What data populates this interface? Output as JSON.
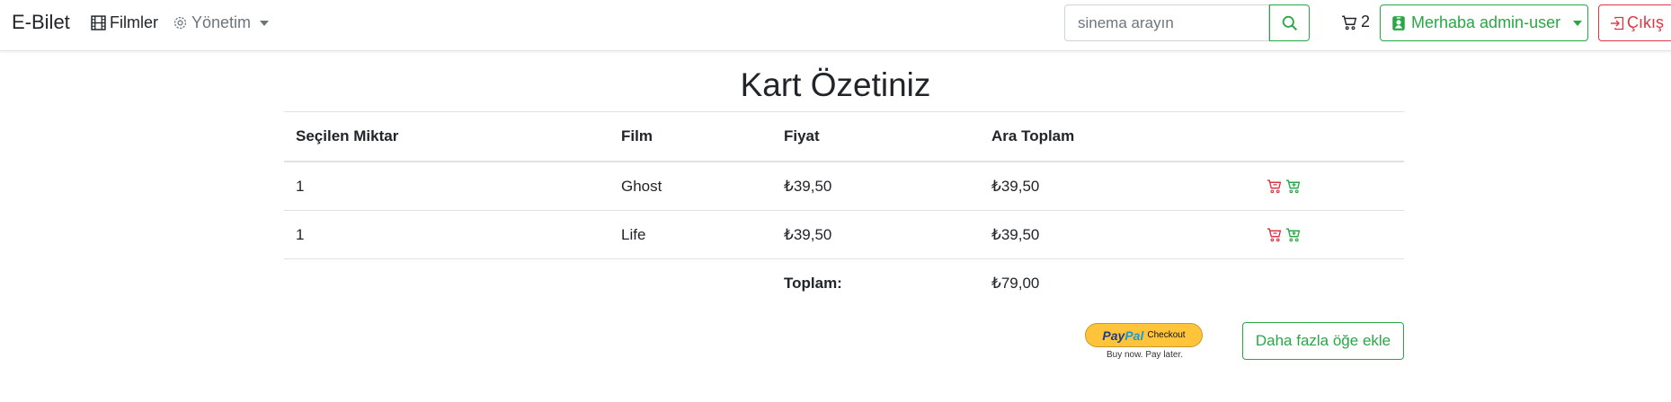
{
  "nav": {
    "brand": "E-Bilet",
    "movies_label": "Filmler",
    "admin_label": "Yönetim",
    "search_placeholder": "sinema arayın",
    "cart_count": "2",
    "user_label": "Merhaba admin-user",
    "logout_label": "Çıkış"
  },
  "page": {
    "title": "Kart Özetiniz"
  },
  "table": {
    "headers": [
      "Seçilen Miktar",
      "Film",
      "Fiyat",
      "Ara Toplam"
    ],
    "rows": [
      {
        "qty": "1",
        "film": "Ghost",
        "price": "₺39,50",
        "subtotal": "₺39,50"
      },
      {
        "qty": "1",
        "film": "Life",
        "price": "₺39,50",
        "subtotal": "₺39,50"
      }
    ],
    "total_label": "Toplam:",
    "total_value": "₺79,00"
  },
  "paypal": {
    "logo_a": "Pay",
    "logo_b": "Pal",
    "checkout": "Checkout",
    "subtext": "Buy now. Pay later."
  },
  "more_button": "Daha fazla öğe ekle",
  "colors": {
    "success": "#28a745",
    "danger": "#dc3545",
    "muted": "#6c757d"
  },
  "icons": [
    "film-icon",
    "gear-icon",
    "search-icon",
    "cart-icon",
    "user-badge-icon",
    "sign-in-icon",
    "cart-remove-icon",
    "cart-add-icon"
  ]
}
